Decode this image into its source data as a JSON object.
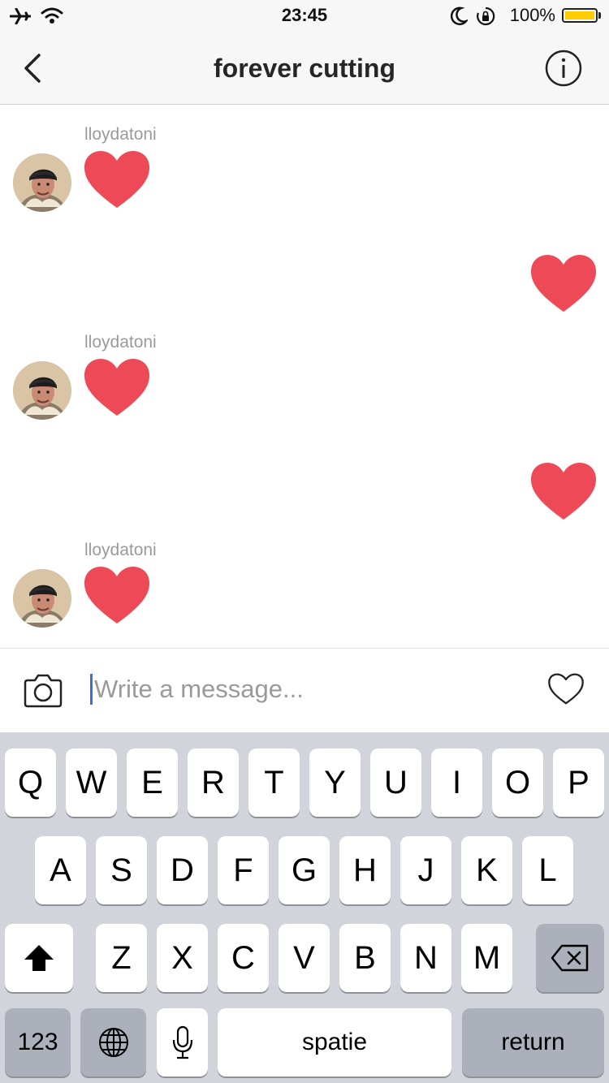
{
  "status_bar": {
    "time": "23:45",
    "battery_percent_text": "100%",
    "battery_level": 1.0,
    "battery_color": "#ffcc00",
    "icons": [
      "airplane-icon",
      "wifi-icon",
      "moon-icon",
      "rotation-lock-icon",
      "battery-icon"
    ]
  },
  "nav": {
    "title": "forever cutting",
    "back_icon": "chevron-left-icon",
    "info_icon": "info-icon"
  },
  "messages": [
    {
      "direction": "incoming",
      "sender": "lloydatoni",
      "content": "heart"
    },
    {
      "direction": "outgoing",
      "content": "heart"
    },
    {
      "direction": "incoming",
      "sender": "lloydatoni",
      "content": "heart"
    },
    {
      "direction": "outgoing",
      "content": "heart"
    },
    {
      "direction": "incoming",
      "sender": "lloydatoni",
      "content": "heart"
    }
  ],
  "heart_color": "#ed4956",
  "composer": {
    "placeholder": "Write a message...",
    "value": "",
    "camera_icon": "camera-icon",
    "like_icon": "heart-outline-icon"
  },
  "keyboard": {
    "row1": [
      "Q",
      "W",
      "E",
      "R",
      "T",
      "Y",
      "U",
      "I",
      "O",
      "P"
    ],
    "row2": [
      "A",
      "S",
      "D",
      "F",
      "G",
      "H",
      "J",
      "K",
      "L"
    ],
    "row3": [
      "Z",
      "X",
      "C",
      "V",
      "B",
      "N",
      "M"
    ],
    "numbers_key": "123",
    "space_key": "spatie",
    "return_key": "return",
    "icons": [
      "shift-icon",
      "backspace-icon",
      "globe-icon",
      "microphone-icon"
    ]
  }
}
